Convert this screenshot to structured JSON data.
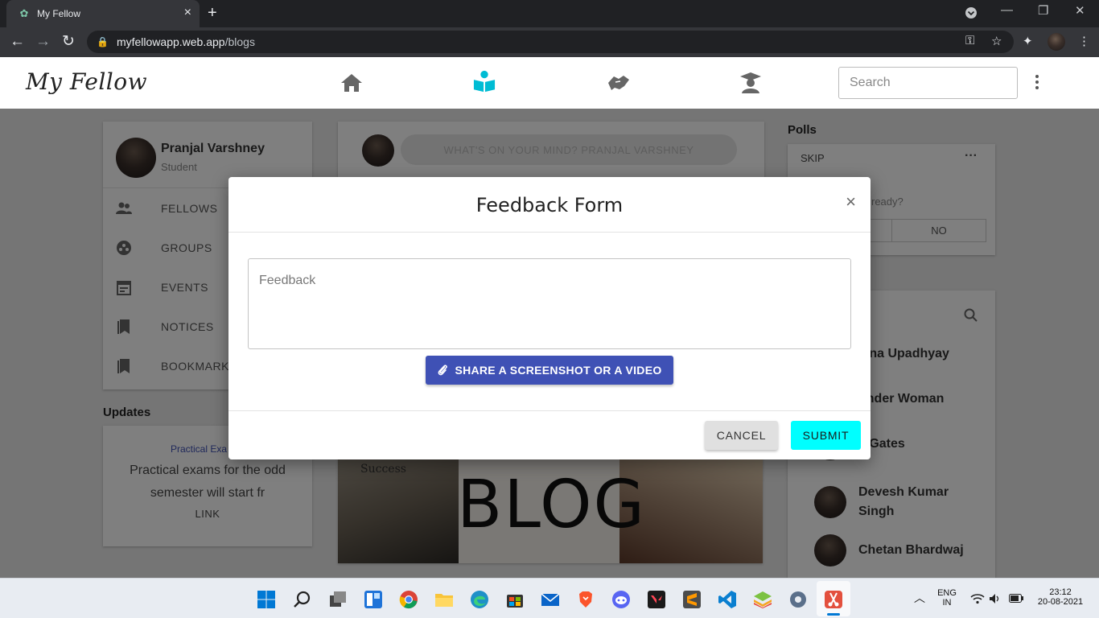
{
  "browser": {
    "tab_title": "My Fellow",
    "tab_close": "×",
    "new_tab": "+",
    "url_domain": "myfellowapp.web.app",
    "url_path": "/blogs"
  },
  "app": {
    "brand": "My Fellow",
    "search_placeholder": "Search",
    "nav_icons": [
      "home-icon",
      "blog-reader-icon",
      "handshake-icon",
      "graduate-icon"
    ],
    "active_color": "#00bcd4"
  },
  "sidebar": {
    "user_name": "Pranjal Varshney",
    "user_role": "Student",
    "items": [
      {
        "label": "FELLOWS",
        "icon": "people-icon"
      },
      {
        "label": "GROUPS",
        "icon": "groups-icon"
      },
      {
        "label": "EVENTS",
        "icon": "calendar-icon"
      },
      {
        "label": "NOTICES",
        "icon": "bookmark-icon"
      },
      {
        "label": "BOOKMARKS",
        "icon": "bookmark-icon"
      }
    ]
  },
  "updates": {
    "title": "Updates",
    "tag": "Practical Exa",
    "text": "Practical exams for the odd semester will start fr",
    "link": "LINK"
  },
  "feed": {
    "post_placeholder": "WHAT'S ON YOUR MIND? PRANJAL VARSHNEY",
    "blog_image_text": "BLOG",
    "blog_image_note": "Success"
  },
  "polls": {
    "title": "Polls",
    "skip": "SKIP",
    "question": "ready?",
    "option_no": "NO"
  },
  "people": [
    {
      "name": "aina Upadhyay"
    },
    {
      "name": "onder Woman"
    },
    {
      "name": "ll Gates"
    },
    {
      "name": "Devesh Kumar Singh"
    },
    {
      "name": "Chetan Bhardwaj"
    }
  ],
  "modal": {
    "title": "Feedback Form",
    "close": "×",
    "feedback_placeholder": "Feedback",
    "share_label": "SHARE A SCREENSHOT OR A VIDEO",
    "cancel_label": "CANCEL",
    "submit_label": "SUBMIT",
    "primary_color": "#3f51b5",
    "submit_color": "#00ffff"
  },
  "taskbar": {
    "lang_top": "ENG",
    "lang_bottom": "IN",
    "time": "23:12",
    "date": "20-08-2021"
  }
}
